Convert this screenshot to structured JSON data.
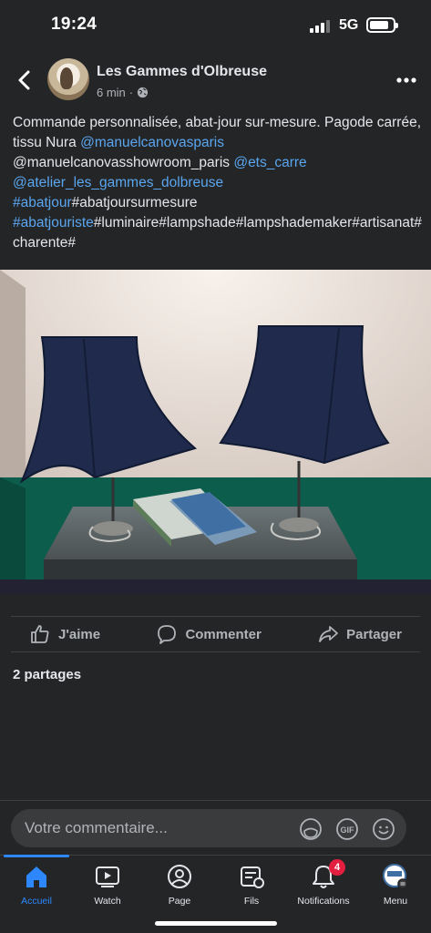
{
  "status_bar": {
    "time": "19:24",
    "network": "5G"
  },
  "post": {
    "author": "Les Gammes d'Olbreuse",
    "time_ago": "6 min",
    "text_segments": [
      {
        "text": "Commande personnalisée, abat-jour sur-mesure. Pagode carrée, tissu Nura ",
        "type": "plain"
      },
      {
        "text": "@manuelcanovasparis",
        "type": "mention"
      },
      {
        "text": "\n@manuelcanovasshowroom_paris ",
        "type": "plain"
      },
      {
        "text": "@ets_carre",
        "type": "mention"
      },
      {
        "text": "\n",
        "type": "plain"
      },
      {
        "text": "@atelier_les_gammes_dolbreuse",
        "type": "mention"
      },
      {
        "text": "\n",
        "type": "plain"
      },
      {
        "text": "#abatjour",
        "type": "hashtag"
      },
      {
        "text": "#abatjoursurmesure\n",
        "type": "plain"
      },
      {
        "text": "#abatjouriste",
        "type": "hashtag"
      },
      {
        "text": "#luminaire#lampshade#lampshademaker#artisanat#charente#",
        "type": "plain"
      }
    ]
  },
  "actions": {
    "like": "J'aime",
    "comment": "Commenter",
    "share": "Partager"
  },
  "shares_count": "2 partages",
  "comment_box": {
    "placeholder": "Votre commentaire..."
  },
  "tabs": [
    {
      "label": "Accueil",
      "icon": "home-icon",
      "active": true
    },
    {
      "label": "Watch",
      "icon": "watch-icon",
      "active": false
    },
    {
      "label": "Page",
      "icon": "page-icon",
      "active": false
    },
    {
      "label": "Fils",
      "icon": "feeds-icon",
      "active": false
    },
    {
      "label": "Notifications",
      "icon": "bell-icon",
      "active": false,
      "badge": "4"
    },
    {
      "label": "Menu",
      "icon": "menu-avatar-icon",
      "active": false
    }
  ],
  "colors": {
    "background": "#242526",
    "accent": "#2d88ff",
    "link": "#5aa6f0",
    "badge": "#e41e3f"
  }
}
